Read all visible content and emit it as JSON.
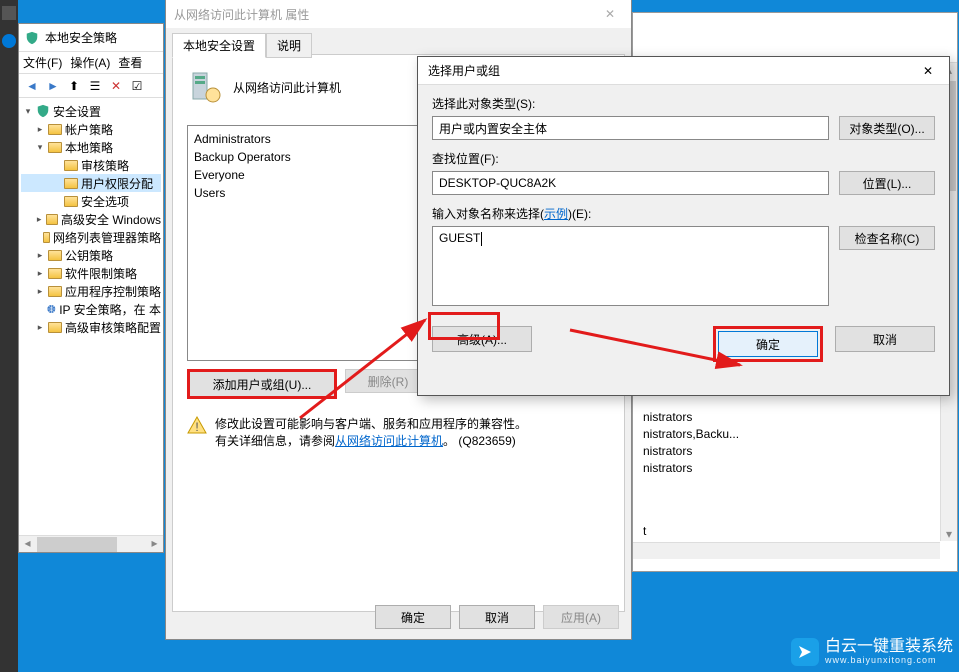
{
  "mmc": {
    "title": "本地安全策略",
    "menu": {
      "file": "文件(F)",
      "action": "操作(A)",
      "view": "查看"
    },
    "tree_root": "安全设置",
    "tree": [
      {
        "label": "帐户策略"
      },
      {
        "label": "本地策略",
        "has_children": true,
        "children": [
          {
            "label": "审核策略"
          },
          {
            "label": "用户权限分配",
            "selected": true
          },
          {
            "label": "安全选项"
          }
        ]
      },
      {
        "label": "高级安全 Windows"
      },
      {
        "label": "网络列表管理器策略"
      },
      {
        "label": "公钥策略"
      },
      {
        "label": "软件限制策略"
      },
      {
        "label": "应用程序控制策略"
      },
      {
        "label": "IP 安全策略，在 本"
      },
      {
        "label": "高级审核策略配置"
      }
    ]
  },
  "properties": {
    "title": "从网络访问此计算机 属性",
    "tabs": {
      "active": "本地安全设置",
      "inactive": "说明"
    },
    "policy_name": "从网络访问此计算机",
    "members": [
      "Administrators",
      "Backup Operators",
      "Everyone",
      "Users"
    ],
    "add_btn": "添加用户或组(U)...",
    "remove_btn": "删除(R)",
    "info_line1": "修改此设置可能影响与客户端、服务和应用程序的兼容性。",
    "info_line2_prefix": "有关详细信息，请参阅",
    "info_link": "从网络访问此计算机",
    "info_line2_suffix": "。 (Q823659)",
    "ok": "确定",
    "cancel": "取消",
    "apply": "应用(A)"
  },
  "mgmt_list": [
    "nistrators",
    "nistrators,Backu...",
    "nistrators",
    "nistrators"
  ],
  "mgmt_footer_item": "t",
  "select_dialog": {
    "title": "选择用户或组",
    "object_type_label": "选择此对象类型(S):",
    "object_type_value": "用户或内置安全主体",
    "object_type_btn": "对象类型(O)...",
    "location_label": "查找位置(F):",
    "location_value": "DESKTOP-QUC8A2K",
    "location_btn": "位置(L)...",
    "name_label_prefix": "输入对象名称来选择(",
    "name_label_link": "示例",
    "name_label_suffix": ")(E):",
    "name_value": "GUEST",
    "check_names_btn": "检查名称(C)",
    "advanced_btn": "高级(A)...",
    "ok": "确定",
    "cancel": "取消"
  },
  "watermark": {
    "cn": "白云一键重装系统",
    "en": "www.baiyunxitong.com"
  },
  "icons": {
    "back": "←",
    "forward": "→",
    "up": "↑",
    "refresh": "⟳",
    "x": "✕",
    "check": "✓"
  }
}
